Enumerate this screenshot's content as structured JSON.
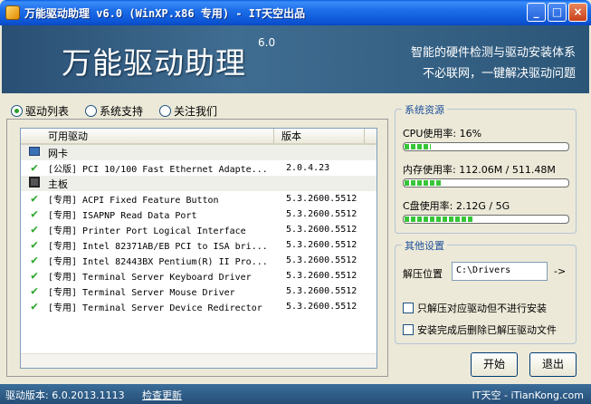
{
  "window": {
    "title": "万能驱动助理 v6.0  (WinXP.x86 专用) - IT天空出品",
    "min_label": "_",
    "max_label": "□",
    "close_label": "×"
  },
  "banner": {
    "brand": "万能驱动助理",
    "version": "6.0",
    "slogan_line1": "智能的硬件检测与驱动安装体系",
    "slogan_line2": "不必联网，一键解决驱动问题"
  },
  "tabs": [
    {
      "label": "驱动列表",
      "selected": true
    },
    {
      "label": "系统支持",
      "selected": false
    },
    {
      "label": "关注我们",
      "selected": false
    }
  ],
  "driver_list": {
    "columns": [
      "可用驱动",
      "版本"
    ],
    "rows": [
      {
        "type": "group",
        "icon": "network-card-icon",
        "name": "网卡",
        "version": ""
      },
      {
        "type": "item",
        "icon": "check-icon",
        "name": "[公版] PCI 10/100 Fast Ethernet Adapte...",
        "version": "2.0.4.23"
      },
      {
        "type": "group",
        "icon": "motherboard-icon",
        "name": "主板",
        "version": ""
      },
      {
        "type": "item",
        "icon": "check-icon",
        "name": "[专用] ACPI Fixed Feature Button",
        "version": "5.3.2600.5512"
      },
      {
        "type": "item",
        "icon": "check-icon",
        "name": "[专用] ISAPNP Read Data Port",
        "version": "5.3.2600.5512"
      },
      {
        "type": "item",
        "icon": "check-icon",
        "name": "[专用] Printer Port Logical Interface",
        "version": "5.3.2600.5512"
      },
      {
        "type": "item",
        "icon": "check-icon",
        "name": "[专用] Intel 82371AB/EB PCI to ISA bri...",
        "version": "5.3.2600.5512"
      },
      {
        "type": "item",
        "icon": "check-icon",
        "name": "[专用] Intel 82443BX Pentium(R) II Pro...",
        "version": "5.3.2600.5512"
      },
      {
        "type": "item",
        "icon": "check-icon",
        "name": "[专用] Terminal Server Keyboard Driver",
        "version": "5.3.2600.5512"
      },
      {
        "type": "item",
        "icon": "check-icon",
        "name": "[专用] Terminal Server Mouse Driver",
        "version": "5.3.2600.5512"
      },
      {
        "type": "item",
        "icon": "check-icon",
        "name": "[专用] Terminal Server Device Redirector",
        "version": "5.3.2600.5512"
      }
    ]
  },
  "system_resources": {
    "title": "系统资源",
    "cpu_label": "CPU使用率:  16%",
    "cpu_fraction": 0.16,
    "mem_label": "内存使用率: 112.06M / 511.48M",
    "mem_fraction": 0.22,
    "disk_label": "C盘使用率:  2.12G / 5G",
    "disk_fraction": 0.42
  },
  "settings": {
    "title": "其他设置",
    "path_label": "解压位置",
    "path_value": "C:\\Drivers",
    "path_arrow": "->",
    "option1": "只解压对应驱动但不进行安装",
    "option2": "安装完成后删除已解压驱动文件"
  },
  "buttons": {
    "start": "开始",
    "exit": "退出"
  },
  "status": {
    "version": "驱动版本: 6.0.2013.1113",
    "update_link": "检查更新",
    "site": "IT天空 - iTianKong.com"
  },
  "colors": {
    "accent": "#2a4f74",
    "check": "#2fa82f",
    "bar_fill": "#37c537"
  }
}
